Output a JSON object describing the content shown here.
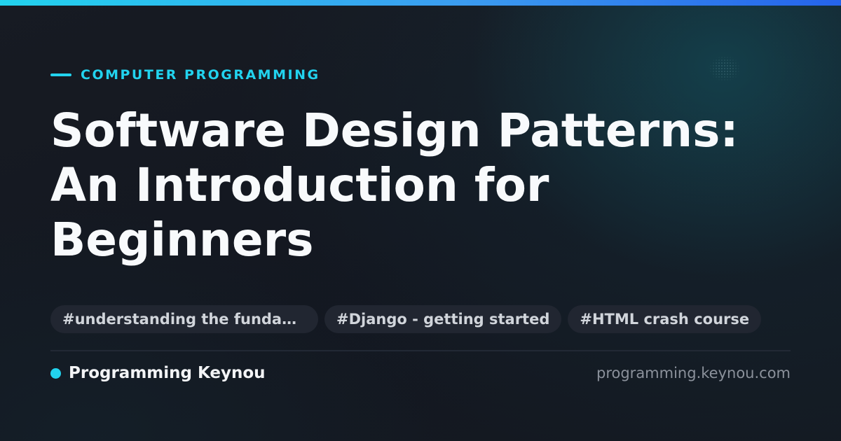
{
  "category": "COMPUTER PROGRAMMING",
  "title_lines": [
    "Software Design Patterns:",
    "An Introduction for",
    "Beginners"
  ],
  "tags": [
    "#understanding the fundamentals",
    "#Django - getting started",
    "#HTML crash course"
  ],
  "site": {
    "name": "Programming Keynou",
    "url": "programming.keynou.com"
  },
  "colors": {
    "accent": "#22d3ee",
    "background": "#141821",
    "tag_background": "#212631",
    "title": "#f8fafc",
    "muted": "#8b919b"
  }
}
